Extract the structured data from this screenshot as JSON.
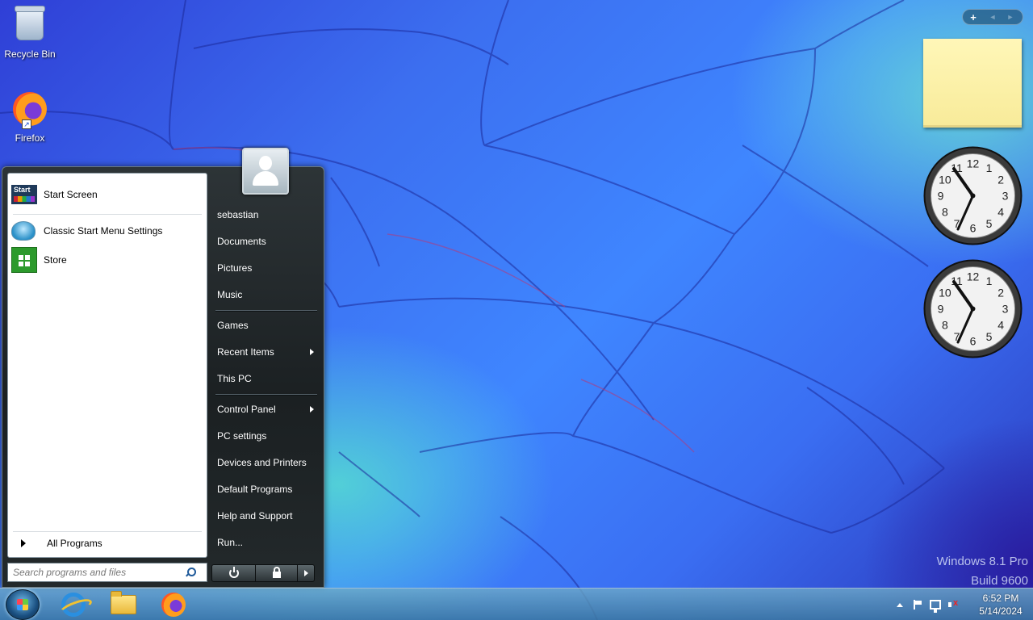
{
  "desktop": {
    "icons": [
      {
        "label": "Recycle Bin",
        "icon": "recycle-bin-icon"
      },
      {
        "label": "Firefox",
        "icon": "firefox-icon"
      }
    ],
    "watermark": {
      "line1": "Windows 8.1 Pro",
      "line2": "Build 9600"
    }
  },
  "start_menu": {
    "left_items": [
      {
        "label": "Start Screen",
        "icon": "start-screen-icon",
        "tile_text": "Start"
      },
      {
        "label": "Classic Start Menu Settings",
        "icon": "shell-icon"
      },
      {
        "label": "Store",
        "icon": "store-icon"
      }
    ],
    "all_programs": "All Programs",
    "search": {
      "placeholder": "Search programs and files",
      "value": ""
    },
    "right_items": [
      {
        "label": "sebastian",
        "has_arrow": false
      },
      {
        "label": "Documents",
        "has_arrow": false
      },
      {
        "label": "Pictures",
        "has_arrow": false
      },
      {
        "label": "Music",
        "has_arrow": false
      },
      {
        "label": "Games",
        "has_arrow": false
      },
      {
        "label": "Recent Items",
        "has_arrow": true
      },
      {
        "label": "This PC",
        "has_arrow": false
      },
      {
        "label": "Control Panel",
        "has_arrow": true
      },
      {
        "label": "PC settings",
        "has_arrow": false
      },
      {
        "label": "Devices and Printers",
        "has_arrow": false
      },
      {
        "label": "Default Programs",
        "has_arrow": false
      },
      {
        "label": "Help and Support",
        "has_arrow": false
      },
      {
        "label": "Run...",
        "has_arrow": false
      }
    ]
  },
  "gadgets": {
    "toolbar": {
      "add": "+",
      "prev": "◄",
      "next": "►"
    },
    "clock_numbers": [
      "12",
      "1",
      "2",
      "3",
      "4",
      "5",
      "6",
      "7",
      "8",
      "9",
      "10",
      "11"
    ]
  },
  "taskbar": {
    "apps": [
      {
        "name": "Internet Explorer",
        "icon": "internet-explorer-icon"
      },
      {
        "name": "File Explorer",
        "icon": "file-explorer-icon"
      },
      {
        "name": "Firefox",
        "icon": "firefox-icon"
      }
    ],
    "tray": {
      "time": "6:52 PM",
      "date": "5/14/2024",
      "icons": [
        "show-hidden-icons-icon",
        "action-center-flag-icon",
        "network-icon",
        "speaker-muted-icon"
      ]
    }
  },
  "colors": {
    "menu_dark": "#1b2022",
    "sticky_note": "#fff7b8",
    "taskbar": "#4a8ab0"
  }
}
